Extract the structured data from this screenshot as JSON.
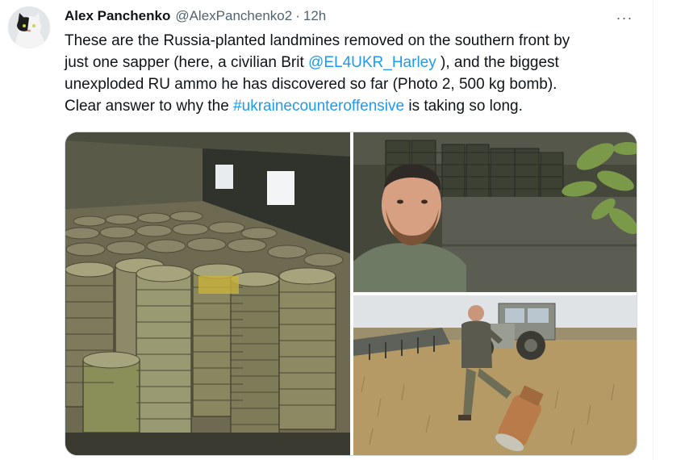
{
  "author": {
    "name": "Alex Panchenko",
    "handle": "@AlexPanchenko2",
    "separator": "·",
    "time": "12h"
  },
  "more_label": "···",
  "tweet": {
    "line1": "These are the Russia-planted landmines removed on the southern front by",
    "line2_pre": "just one sapper (here, a civilian Brit ",
    "line2_mention": "@EL4UKR_Harley",
    "line2_post": " ), and the biggest",
    "line3": "unexploded RU ammo he has discovered so far (Photo 2, 500 kg bomb).",
    "line4_pre": "Clear answer to why the ",
    "line4_hashtag": "#ukrainecounteroffensive",
    "line4_post": " is taking so long."
  },
  "icons": {
    "more": "more-horizontal-icon"
  },
  "colors": {
    "link": "#1d9bf0",
    "secondary_text": "#536471",
    "border": "#cfd9de"
  }
}
